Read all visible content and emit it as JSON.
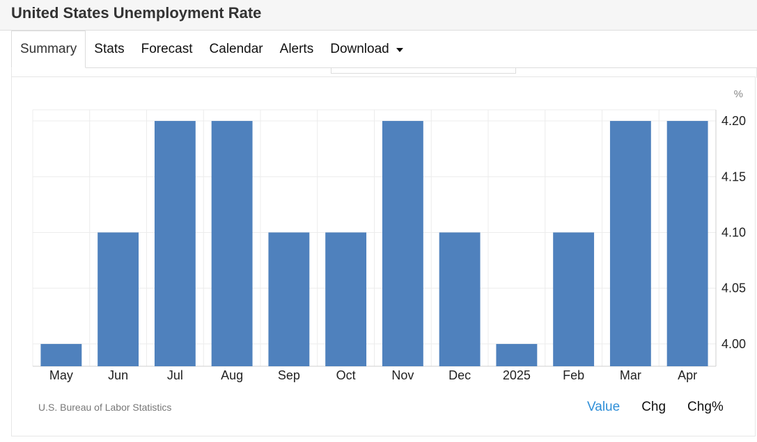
{
  "header": {
    "title": "United States Unemployment Rate"
  },
  "tabs": [
    {
      "label": "Summary",
      "active": true
    },
    {
      "label": "Stats"
    },
    {
      "label": "Forecast"
    },
    {
      "label": "Calendar"
    },
    {
      "label": "Alerts"
    },
    {
      "label": "Download",
      "dropdown": true
    }
  ],
  "colors": {
    "bar": "#4f81bd",
    "grid": "#ececec",
    "active_toggle": "#2f8fd8"
  },
  "chart_data": {
    "type": "bar",
    "unit": "%",
    "categories": [
      "May",
      "Jun",
      "Jul",
      "Aug",
      "Sep",
      "Oct",
      "Nov",
      "Dec",
      "2025",
      "Feb",
      "Mar",
      "Apr"
    ],
    "values": [
      4.0,
      4.1,
      4.2,
      4.2,
      4.1,
      4.1,
      4.2,
      4.1,
      4.0,
      4.1,
      4.2,
      4.2
    ],
    "ylim": [
      3.98,
      4.21
    ],
    "yticks": [
      4.0,
      4.05,
      4.1,
      4.15,
      4.2
    ],
    "ytick_labels": [
      "4.00",
      "4.05",
      "4.10",
      "4.15",
      "4.20"
    ],
    "y_axis_side": "right",
    "grid": true
  },
  "footer": {
    "source": "U.S. Bureau of Labor Statistics",
    "toggles": [
      {
        "label": "Value",
        "active": true
      },
      {
        "label": "Chg"
      },
      {
        "label": "Chg%"
      }
    ]
  }
}
